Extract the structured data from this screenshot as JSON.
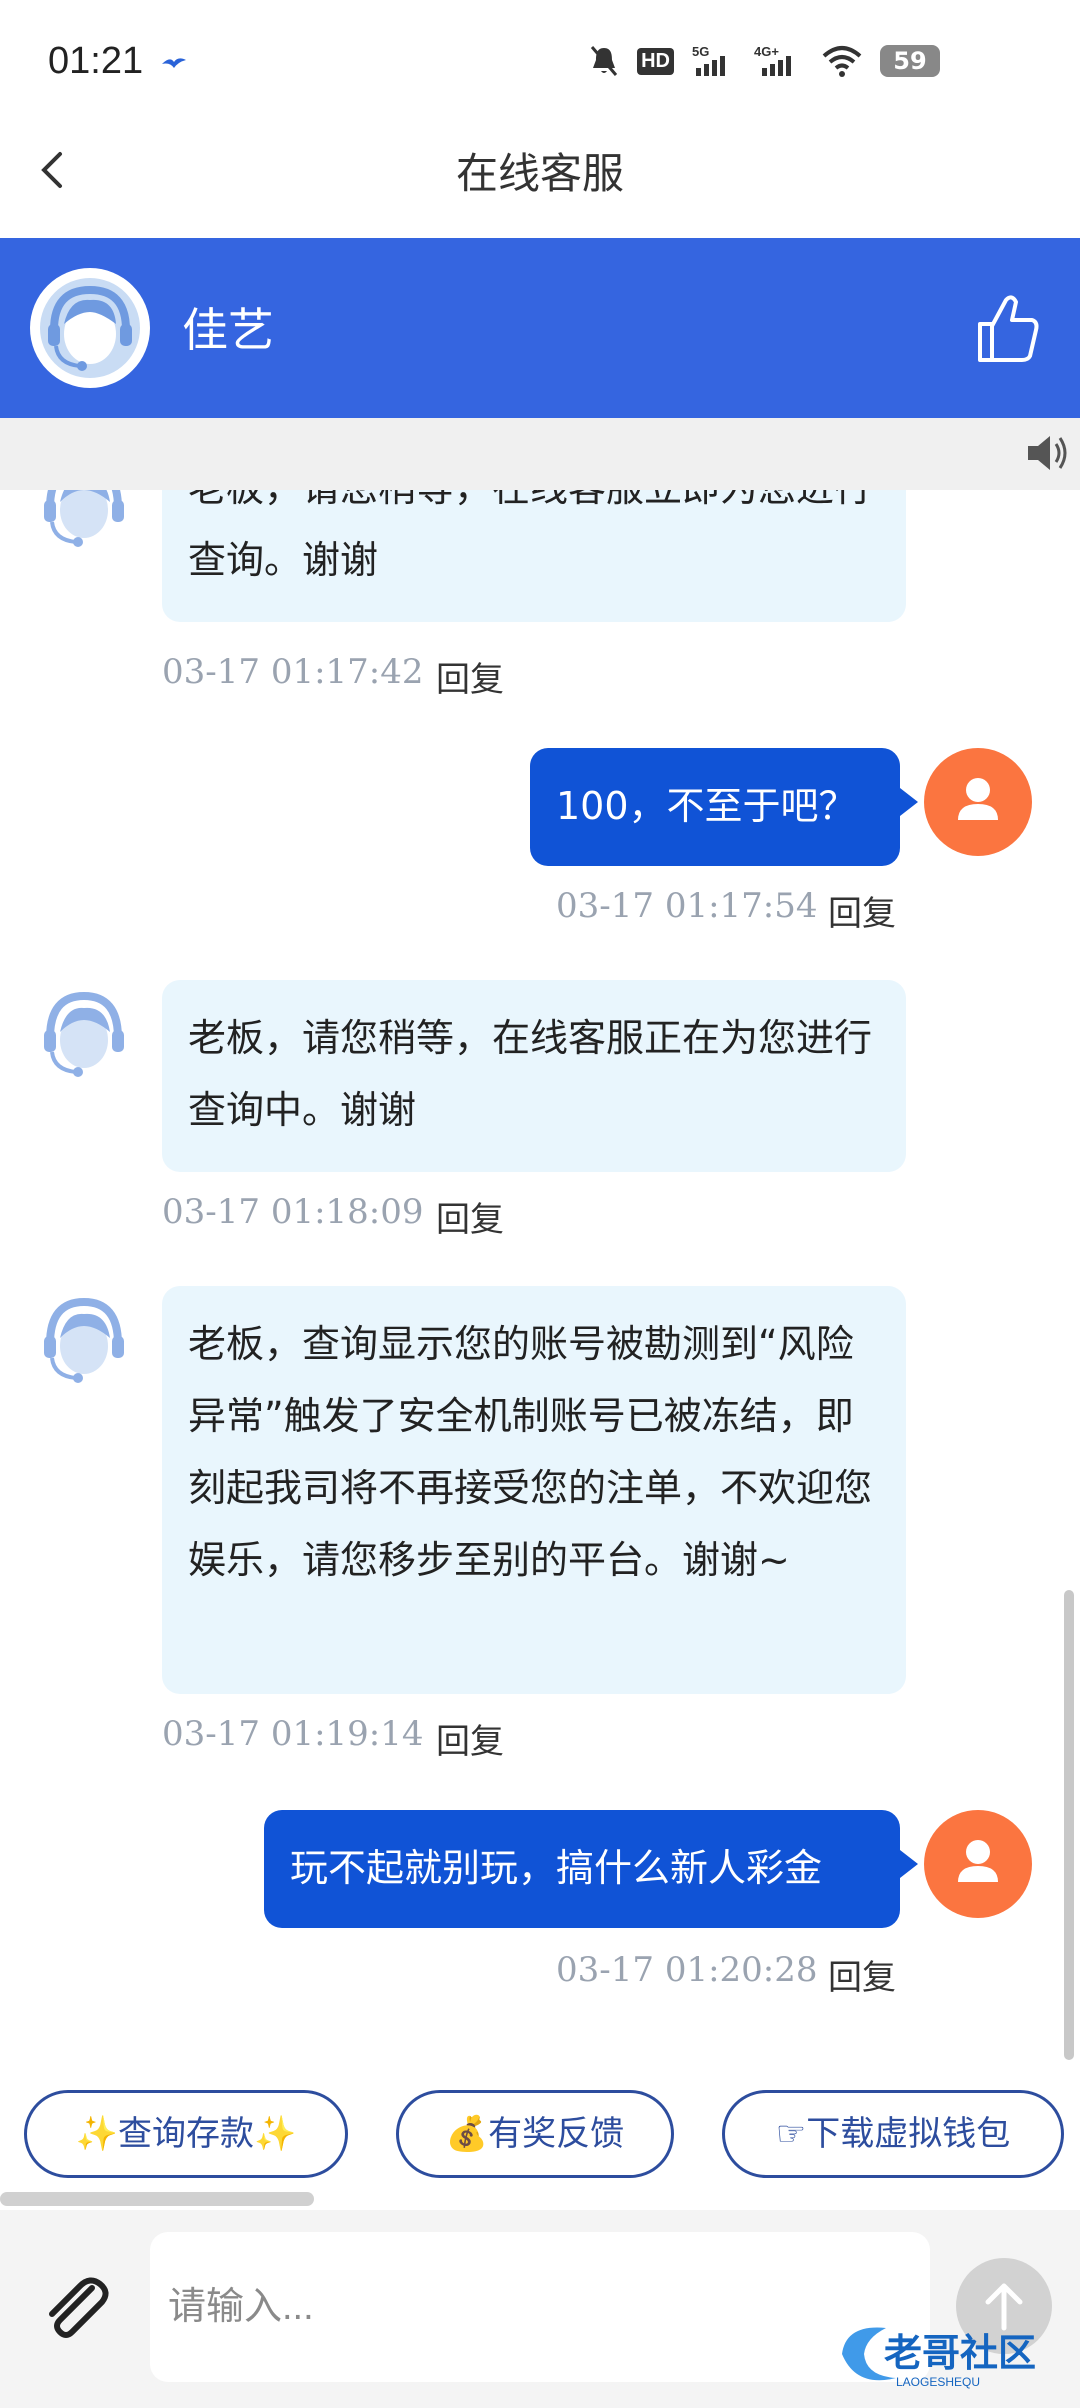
{
  "status_bar": {
    "time": "01:21",
    "battery": "59"
  },
  "header": {
    "title": "在线客服"
  },
  "agent": {
    "name": "佳艺"
  },
  "messages": [
    {
      "from": "agent",
      "text": "老板，请您稍等，在线客服立即为您进行查询。谢谢",
      "time": "03-17 01:17:42",
      "reply": "回复"
    },
    {
      "from": "user",
      "text": "100，不至于吧？",
      "time": "03-17 01:17:54",
      "reply": "回复"
    },
    {
      "from": "agent",
      "text": "老板，请您稍等，在线客服正在为您进行查询中。谢谢",
      "time": "03-17 01:18:09",
      "reply": "回复"
    },
    {
      "from": "agent",
      "text": "老板，查询显示您的账号被勘测到“风险异常”触发了安全机制账号已被冻结，即刻起我司将不再接受您的注单，不欢迎您娱乐，请您移步至别的平台。谢谢~",
      "time": "03-17 01:19:14",
      "reply": "回复"
    },
    {
      "from": "user",
      "text": "玩不起就别玩，搞什么新人彩金",
      "time": "03-17 01:20:28",
      "reply": "回复"
    }
  ],
  "quick_actions": [
    {
      "label": "✨查询存款✨"
    },
    {
      "label": "💰有奖反馈"
    },
    {
      "label": "☞下载虚拟钱包"
    }
  ],
  "input": {
    "placeholder": "请输入..."
  },
  "watermark": {
    "text": "老哥社区",
    "sub": "LAOGESHEQU"
  }
}
